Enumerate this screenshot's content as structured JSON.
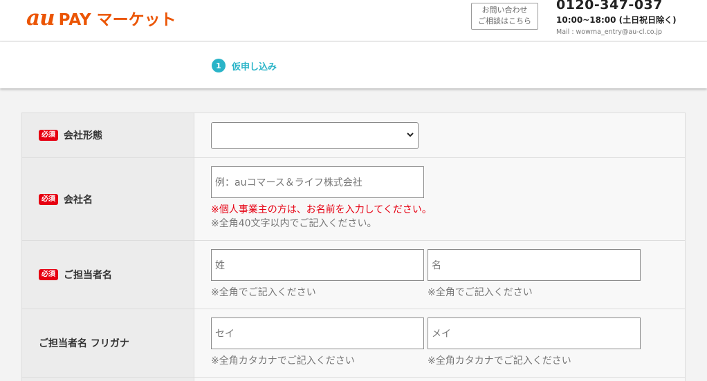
{
  "header": {
    "logo_au": "au",
    "logo_text": "PAY マーケット",
    "contact_line1": "お問い合わせ",
    "contact_line2": "ご相談はこちら",
    "phone": "0120-347-037",
    "hours": "10:00~18:00 (土日祝日除く)",
    "mail": "Mail : wowma_entry@au-cl.co.jp"
  },
  "steps": [
    {
      "num": "1",
      "label": "仮申し込み"
    }
  ],
  "form": {
    "required_badge": "必須",
    "company_type": {
      "label": "会社形態",
      "value": ""
    },
    "company_name": {
      "label": "会社名",
      "placeholder": "例：auコマース＆ライフ株式会社",
      "note_red": "※個人事業主の方は、お名前を入力してください。",
      "note": "※全角40文字以内でご記入ください。"
    },
    "contact_name": {
      "label": "ご担当者名",
      "last_placeholder": "姓",
      "first_placeholder": "名",
      "note": "※全角でご記入ください"
    },
    "contact_kana": {
      "label": "ご担当者名 フリガナ",
      "last_placeholder": "セイ",
      "first_placeholder": "メイ",
      "note": "※全角カタカナでご記入ください"
    }
  }
}
